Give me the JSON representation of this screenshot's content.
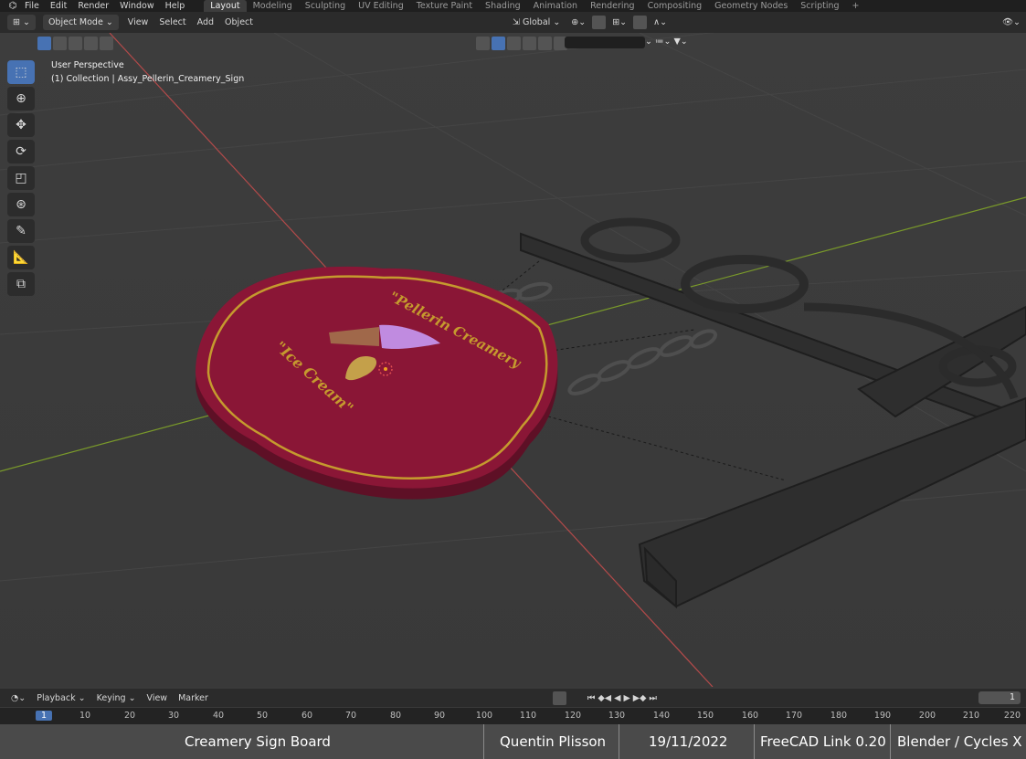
{
  "menu": [
    "File",
    "Edit",
    "Render",
    "Window",
    "Help"
  ],
  "workspaces": [
    "Layout",
    "Modeling",
    "Sculpting",
    "UV Editing",
    "Texture Paint",
    "Shading",
    "Animation",
    "Rendering",
    "Compositing",
    "Geometry Nodes",
    "Scripting",
    "+"
  ],
  "active_workspace": "Layout",
  "header": {
    "mode": "Object Mode",
    "view": "View",
    "select": "Select",
    "add": "Add",
    "object": "Object",
    "orientation": "Global"
  },
  "viewport": {
    "perspective": "User Perspective",
    "collection": "(1) Collection | Assy_Pellerin_Creamery_Sign",
    "sign_top_text": "\"Pellerin Creamery",
    "sign_left_text": "\"Ice Cream\""
  },
  "timeline": {
    "playback": "Playback",
    "keying": "Keying",
    "view": "View",
    "marker": "Marker",
    "current_frame": "1",
    "ticks": [
      "1",
      "10",
      "20",
      "30",
      "40",
      "50",
      "60",
      "70",
      "80",
      "90",
      "100",
      "110",
      "120",
      "130",
      "140",
      "150",
      "160",
      "170",
      "180",
      "190",
      "200",
      "210",
      "220"
    ]
  },
  "credits": {
    "title": "Creamery Sign Board",
    "author": "Quentin Plisson",
    "date": "19/11/2022",
    "tool": "FreeCAD Link 0.20",
    "renderer": "Blender / Cycles X"
  },
  "colors": {
    "accent": "#4772b3",
    "sign": "#8a1636",
    "x_axis": "#b34a4a",
    "y_axis": "#7a9a2a"
  }
}
